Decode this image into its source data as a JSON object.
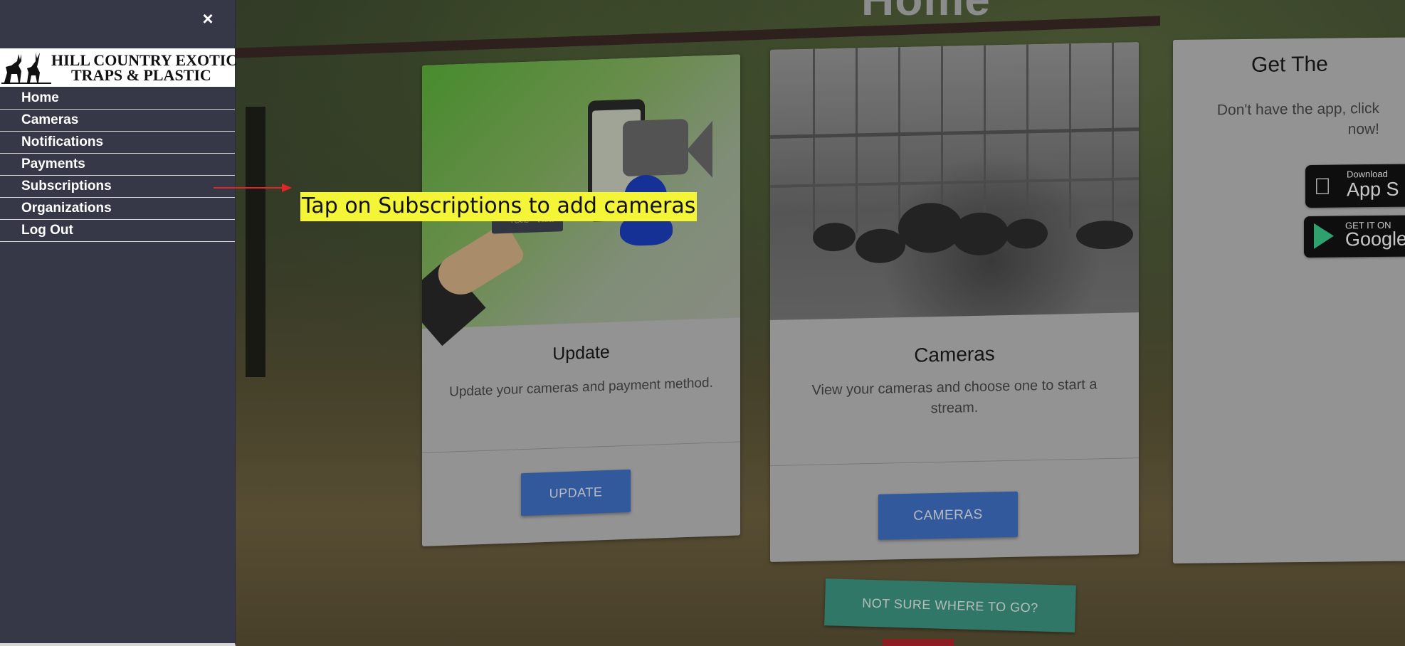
{
  "page": {
    "title": "Home"
  },
  "sidebar": {
    "close_icon": "×",
    "logo": {
      "line1": "HILL COUNTRY EXOTIC",
      "line2": "TRAPS & PLASTIC"
    },
    "items": [
      {
        "label": "Home"
      },
      {
        "label": "Cameras"
      },
      {
        "label": "Notifications"
      },
      {
        "label": "Payments"
      },
      {
        "label": "Subscriptions"
      },
      {
        "label": "Organizations"
      },
      {
        "label": "Log Out"
      }
    ]
  },
  "cards": {
    "update": {
      "title": "Update",
      "text": "Update your cameras and payment method.",
      "button": "UPDATE",
      "card_text_1": "T CARD",
      "card_text_2": "\"0.08/25"
    },
    "cameras": {
      "title": "Cameras",
      "text": "View your cameras and choose one to start a stream.",
      "button": "CAMERAS"
    },
    "get_app": {
      "title": "Get The",
      "text": "Don't have the app, click now!",
      "apple_badge": {
        "small": "Download",
        "big": "App S"
      },
      "google_badge": {
        "small": "GET IT ON",
        "big": "Google"
      }
    }
  },
  "help_button": "NOT SURE WHERE TO GO?",
  "annotation": {
    "text": "Tap on Subscriptions to add cameras"
  },
  "colors": {
    "sidebar_bg": "#363848",
    "button_blue": "#4272c9",
    "button_teal": "#3f9985",
    "annotation_highlight": "#f5f537",
    "arrow_red": "#e0262b"
  }
}
